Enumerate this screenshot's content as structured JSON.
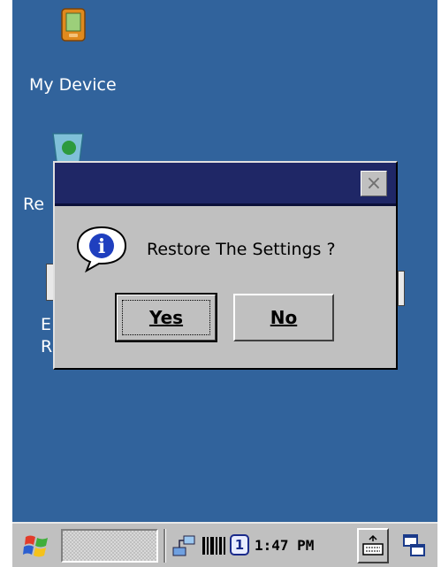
{
  "desktop": {
    "icons": [
      {
        "name": "my-device",
        "label": "My Device",
        "icon": "pda-icon"
      },
      {
        "name": "recycle-bin",
        "label": "Re",
        "icon": "recycle-bin-icon"
      },
      {
        "name": "shortcut",
        "label": "E",
        "label2": "R",
        "icon": "shortcut-icon"
      }
    ]
  },
  "dialog": {
    "title": "",
    "message": "Restore The Settings ?",
    "icon": "info-icon",
    "yes_label": "Yes",
    "no_label": "No",
    "close_glyph": "×"
  },
  "taskbar": {
    "start_icon": "windows-flag-icon",
    "clock": "1:47 PM",
    "tray_icons": [
      "network-icon",
      "barcode-icon",
      "input-mode-1-icon"
    ],
    "input_mode": "1",
    "keyboard_icon": "keyboard-icon",
    "desktop_icon": "show-desktop-icon"
  },
  "colors": {
    "desktop_bg": "#31639c",
    "titlebar": "#1f2766",
    "dialog_bg": "#c0c0c0",
    "taskbar_bg": "#c0c0c0"
  }
}
